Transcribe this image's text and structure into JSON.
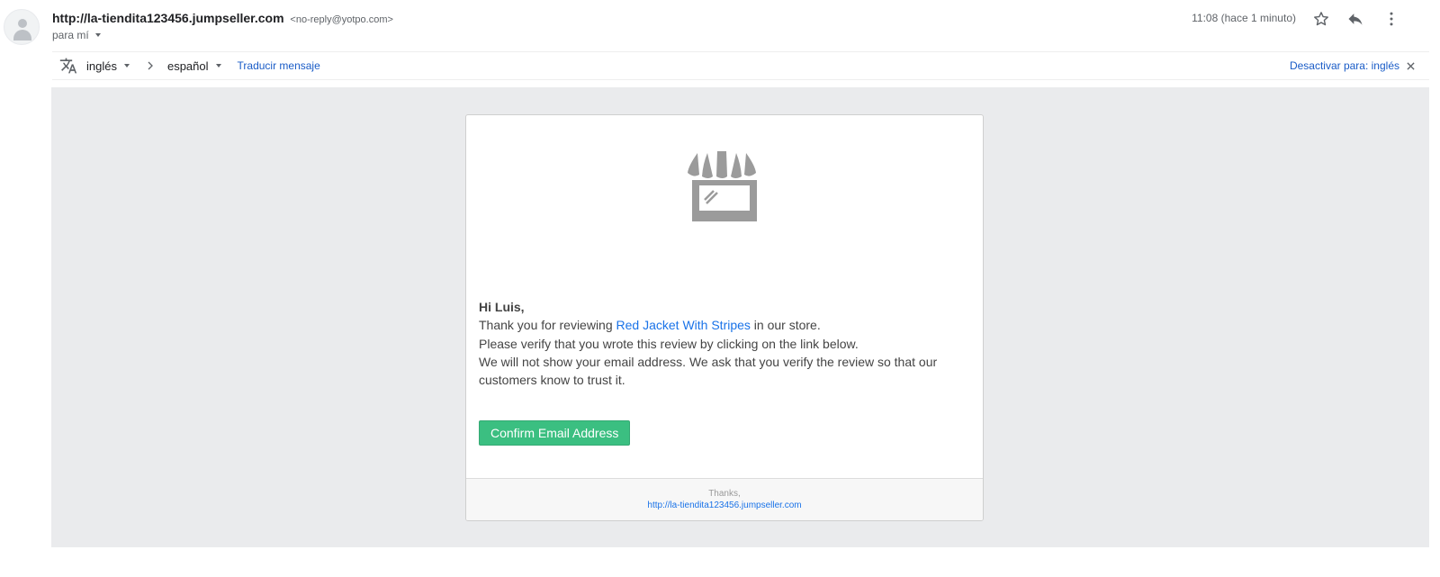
{
  "email_header": {
    "sender_name": "http://la-tiendita123456.jumpseller.com",
    "sender_email": "<no-reply@yotpo.com>",
    "recipient": "para mí",
    "time": "11:08 (hace 1 minuto)"
  },
  "translate_bar": {
    "source_lang": "inglés",
    "target_lang": "español",
    "translate_label": "Traducir mensaje",
    "disable_label": "Desactivar para: inglés"
  },
  "email_body": {
    "greeting": "Hi Luis,",
    "line1_before": "Thank you for reviewing ",
    "product_link": "Red Jacket With Stripes",
    "line1_after": " in our store.",
    "line2": "Please verify that you wrote this review by clicking on the link below.",
    "line3": "We will not show your email address. We ask that you verify the review so that our customers know to trust it.",
    "confirm_button": "Confirm Email Address",
    "footer_thanks": "Thanks,",
    "footer_link": "http://la-tiendita123456.jumpseller.com"
  },
  "icons": {
    "avatar": "person-placeholder-icon",
    "star": "star-outline-icon",
    "reply": "reply-icon",
    "more": "more-vertical-icon",
    "translate": "translate-icon",
    "store": "storefront-icon",
    "close": "close-icon"
  },
  "colors": {
    "link": "#1a73e8",
    "confirm_button": "#3bbf81",
    "email_background": "#eaebed",
    "store_icon": "#9b9b9b"
  }
}
